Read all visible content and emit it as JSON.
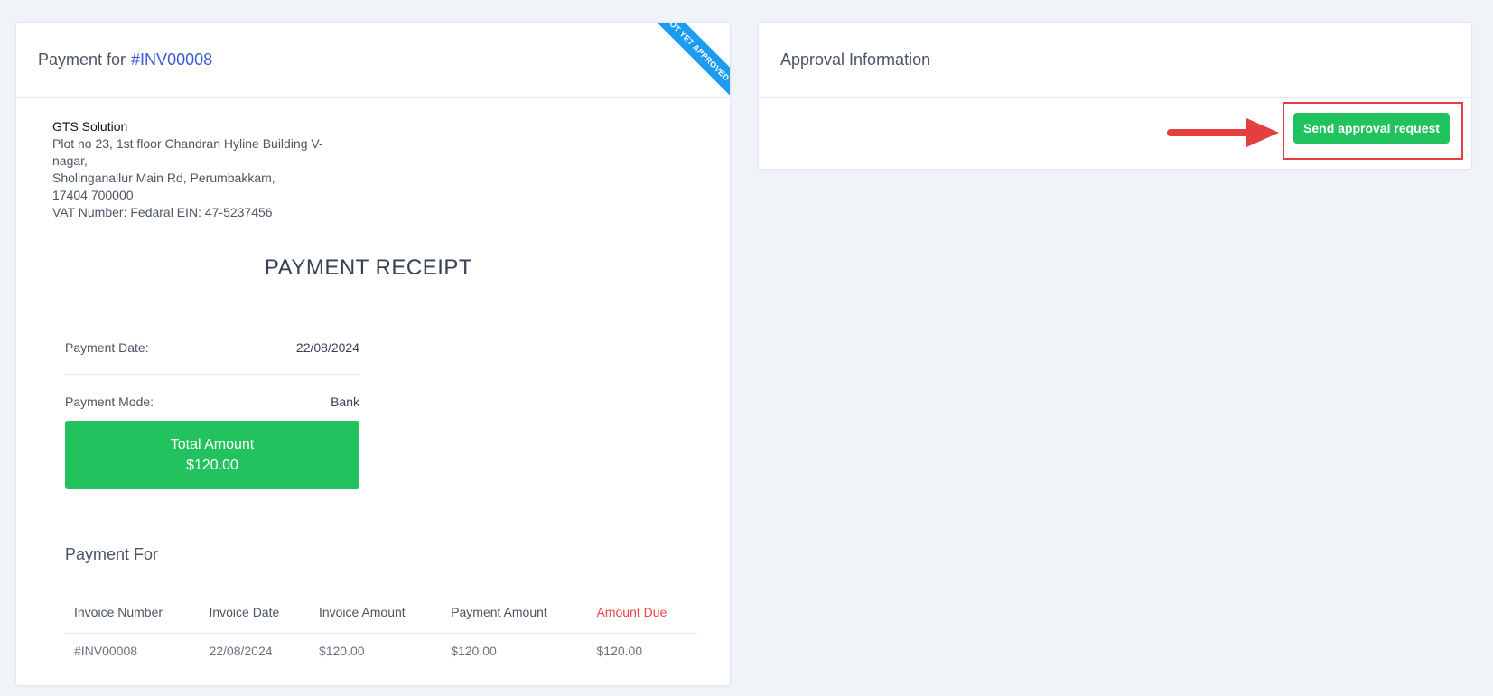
{
  "left_card": {
    "header_prefix": "Payment for",
    "invoice_link": "#INV00008",
    "ribbon_text": "NOT YET APPROVED",
    "company": {
      "name": "GTS Solution",
      "address_line1": "Plot no 23, 1st floor Chandran Hyline Building V-nagar,",
      "address_line2": "Sholinganallur Main Rd, Perumbakkam,",
      "address_line3": "17404 700000",
      "vat": "VAT Number: Fedaral EIN: 47-5237456"
    },
    "receipt_title": "PAYMENT RECEIPT",
    "payment_date_label": "Payment Date:",
    "payment_date_value": "22/08/2024",
    "payment_mode_label": "Payment Mode:",
    "payment_mode_value": "Bank",
    "total_label": "Total Amount",
    "total_value": "$120.00",
    "payment_for_title": "Payment For",
    "table": {
      "headers": [
        "Invoice Number",
        "Invoice Date",
        "Invoice Amount",
        "Payment Amount",
        "Amount Due"
      ],
      "rows": [
        [
          "#INV00008",
          "22/08/2024",
          "$120.00",
          "$120.00",
          "$120.00"
        ]
      ]
    }
  },
  "right_card": {
    "title": "Approval Information",
    "send_button": "Send approval request"
  },
  "colors": {
    "accent_green": "#22c35e",
    "link_blue": "#3b5bdb",
    "ribbon_blue": "#1d9bf0",
    "due_red": "#ef4444",
    "highlight_red": "#e53e3e"
  }
}
